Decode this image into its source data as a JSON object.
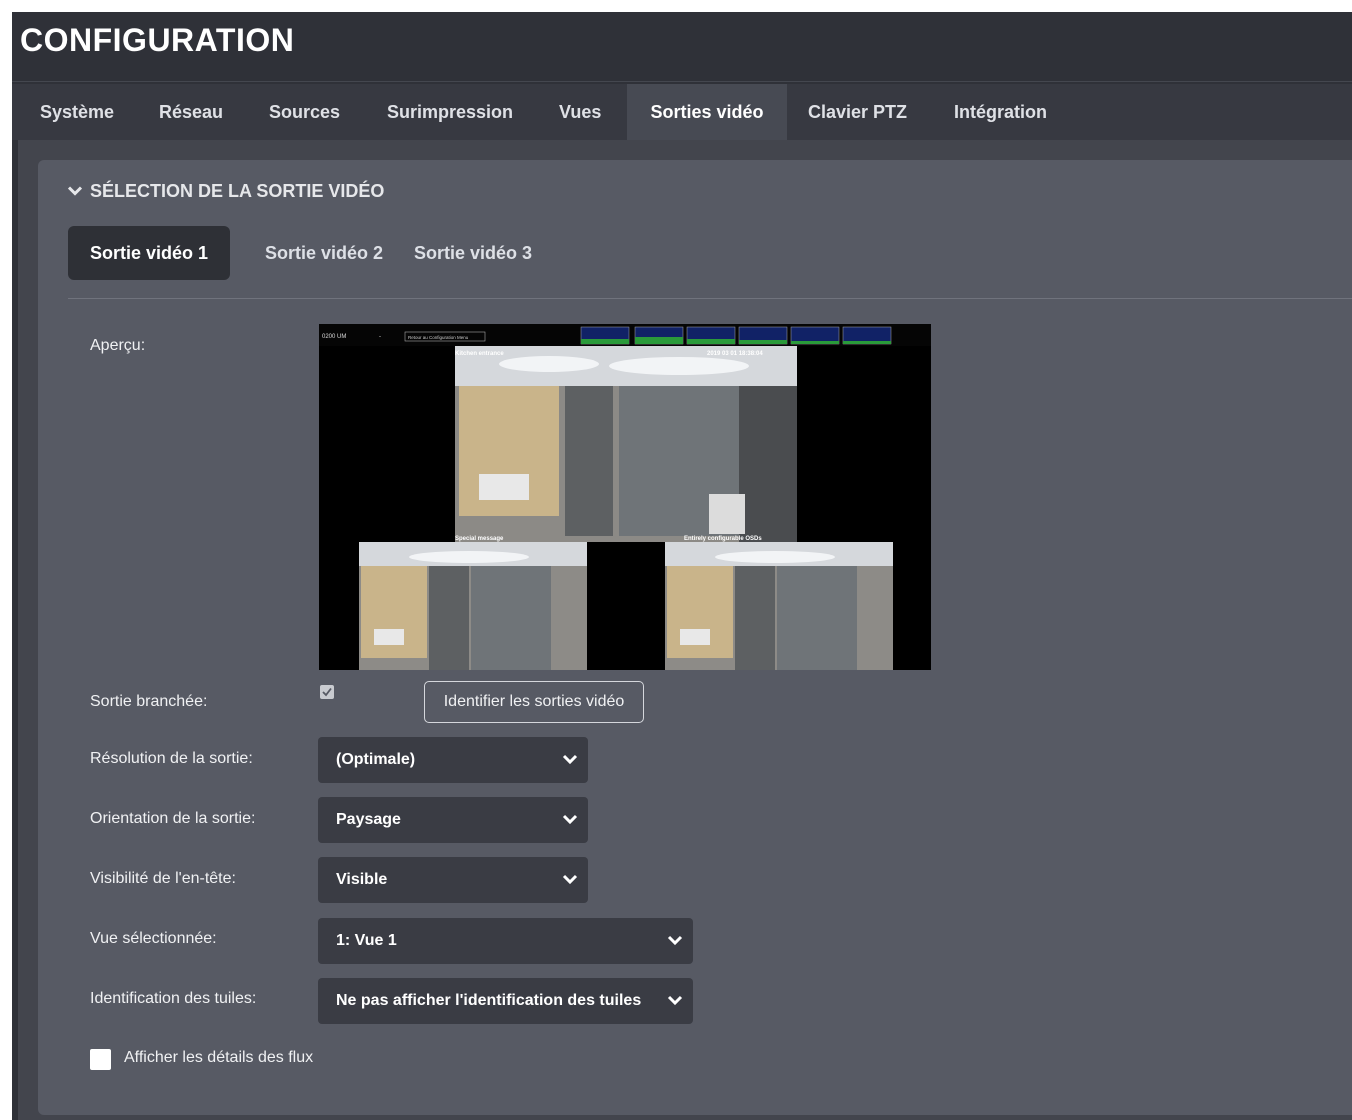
{
  "app": {
    "title": "CONFIGURATION"
  },
  "tabs": [
    {
      "label": "Système"
    },
    {
      "label": "Réseau"
    },
    {
      "label": "Sources"
    },
    {
      "label": "Surimpression"
    },
    {
      "label": "Vues"
    },
    {
      "label": "Sorties vidéo",
      "active": true
    },
    {
      "label": "Clavier PTZ"
    },
    {
      "label": "Intégration"
    }
  ],
  "section": {
    "title": "SÉLECTION DE LA SORTIE VIDÉO",
    "icon": "chevron-down-icon",
    "subtabs": [
      {
        "label": "Sortie vidéo 1",
        "active": true
      },
      {
        "label": "Sortie vidéo 2"
      },
      {
        "label": "Sortie vidéo 3"
      }
    ]
  },
  "form": {
    "preview_label": "Aperçu:",
    "preview_overlay": {
      "top_left": "0200 UM",
      "dash": "-",
      "menu_button": "Retour au Configuration Menu",
      "tile1_name": "Kitchen entrance",
      "tile1_time": "2019 03 01  18:38:04",
      "tile2_name": "Special message",
      "tile3_name": "Entirely configurable OSDs"
    },
    "connected": {
      "label": "Sortie branchée:",
      "checked": true
    },
    "identify_button": "Identifier les sorties vidéo",
    "resolution": {
      "label": "Résolution de la sortie:",
      "value": "(Optimale)"
    },
    "orientation": {
      "label": "Orientation de la sortie:",
      "value": "Paysage"
    },
    "header_visibility": {
      "label": "Visibilité de l'en-tête:",
      "value": "Visible"
    },
    "selected_view": {
      "label": "Vue sélectionnée:",
      "value": "1: Vue 1"
    },
    "tile_identification": {
      "label": "Identification des tuiles:",
      "value": "Ne pas afficher l'identification des tuiles"
    },
    "show_stream_details": {
      "label": "Afficher les détails des flux",
      "checked": false
    }
  },
  "colors": {
    "background": "#2f3138",
    "tab_bar": "#373941",
    "panel": "#575a64",
    "select": "#3a3c44",
    "accent_active_subtab": "#2e3036"
  }
}
